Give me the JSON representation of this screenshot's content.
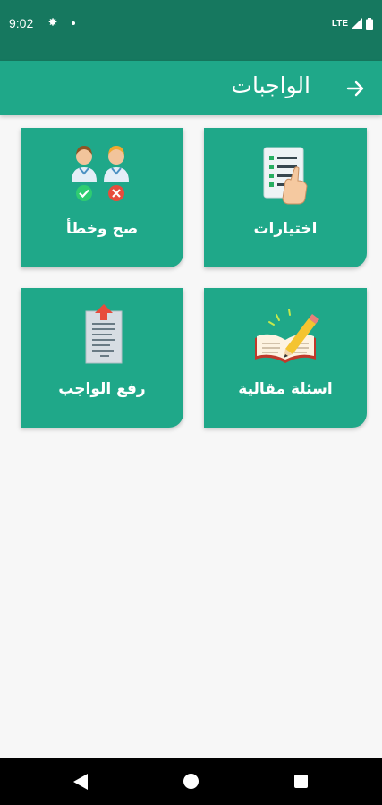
{
  "status_bar": {
    "time": "9:02",
    "network": "LTE"
  },
  "app_bar": {
    "title": "الواجبات"
  },
  "cards": [
    {
      "label": "اختيارات",
      "icon": "checklist-hand-icon"
    },
    {
      "label": "صح وخطأ",
      "icon": "true-false-people-icon"
    },
    {
      "label": "اسئلة مقالية",
      "icon": "open-book-pencil-icon"
    },
    {
      "label": "رفع الواجب",
      "icon": "upload-document-icon"
    }
  ],
  "colors": {
    "status_bar": "#16785f",
    "app_bar": "#1fa889",
    "card": "#1fa889",
    "background": "#f7f7f7"
  }
}
